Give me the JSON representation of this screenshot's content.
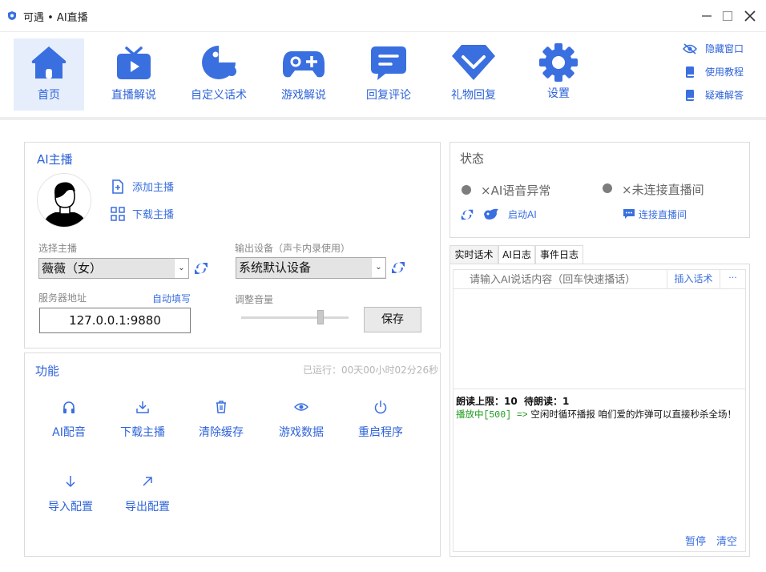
{
  "window": {
    "title": "可遇 • AI直播",
    "controls": [
      "minimize",
      "maximize",
      "close"
    ]
  },
  "nav": {
    "items": [
      {
        "label": "首页",
        "icon": "home-icon",
        "active": true
      },
      {
        "label": "直播解说",
        "icon": "tv-icon"
      },
      {
        "label": "自定义话术",
        "icon": "pacman-icon"
      },
      {
        "label": "游戏解说",
        "icon": "gamepad-icon"
      },
      {
        "label": "回复评论",
        "icon": "comment-icon"
      },
      {
        "label": "礼物回复",
        "icon": "gift-chevron-icon"
      },
      {
        "label": "设置",
        "icon": "gear-icon"
      }
    ],
    "side_links": [
      {
        "label": "隐藏窗口",
        "icon": "eye-off-icon"
      },
      {
        "label": "使用教程",
        "icon": "book-icon"
      },
      {
        "label": "疑难解答",
        "icon": "book-icon"
      }
    ]
  },
  "anchor_panel": {
    "title": "AI主播",
    "add_anchor": "添加主播",
    "download_anchor": "下载主播",
    "select_anchor_label": "选择主播",
    "select_anchor_value": "薇薇（女）",
    "output_device_label": "输出设备（声卡内录使用）",
    "output_device_value": "系统默认设备",
    "server_label": "服务器地址",
    "auto_fill": "自动填写",
    "server_value": "127.0.0.1:9880",
    "volume_label": "调整音量",
    "volume_level": 0.75,
    "save_button": "保存"
  },
  "function_panel": {
    "title": "功能",
    "runtime": "已运行：00天00小时02分26秒",
    "buttons": [
      {
        "label": "AI配音",
        "icon": "headphones-icon"
      },
      {
        "label": "下载主播",
        "icon": "download-icon"
      },
      {
        "label": "清除缓存",
        "icon": "trash-icon"
      },
      {
        "label": "游戏数据",
        "icon": "eye-icon"
      },
      {
        "label": "重启程序",
        "icon": "power-icon"
      },
      {
        "label": "导入配置",
        "icon": "arrow-down-icon"
      },
      {
        "label": "导出配置",
        "icon": "arrow-up-right-icon"
      }
    ]
  },
  "status_panel": {
    "title": "状态",
    "voice_status": "×AI语音异常",
    "live_status": "×未连接直播间",
    "start_ai": "启动AI",
    "connect_live": "连接直播间"
  },
  "log_panel": {
    "tabs": [
      "实时话术",
      "AI日志",
      "事件日志"
    ],
    "active_tab": 0,
    "input_placeholder": "请输入AI说话内容（回车快速播话）",
    "insert_button": "插入话术",
    "more_button": "···",
    "read_limit": "朗读上限：10  待朗读：1",
    "playing_prefix": "播放中[500] =>",
    "playing_text": "空闲时循环播报 咱们爱的炸弹可以直接秒杀全场！",
    "pause": "暂停",
    "clear": "清空"
  },
  "colors": {
    "accent": "#2e63d9",
    "active_nav_bg": "#e6eefc",
    "playing_green": "#1a9a1a"
  }
}
